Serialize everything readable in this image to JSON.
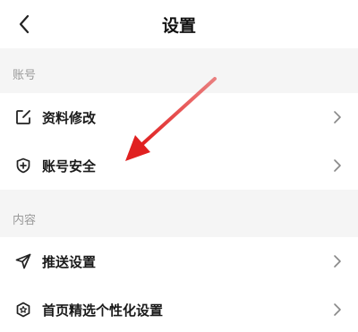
{
  "header": {
    "title": "设置",
    "back_icon": "chevron-left-icon"
  },
  "sections": [
    {
      "label": "账号",
      "items": [
        {
          "label": "资料修改",
          "icon": "edit-icon"
        },
        {
          "label": "账号安全",
          "icon": "shield-plus-icon"
        }
      ]
    },
    {
      "label": "内容",
      "items": [
        {
          "label": "推送设置",
          "icon": "send-icon"
        },
        {
          "label": "首页精选个性化设置",
          "icon": "hexagon-icon"
        }
      ]
    }
  ],
  "annotation": {
    "color": "#e02020",
    "points_to": "账号安全"
  }
}
